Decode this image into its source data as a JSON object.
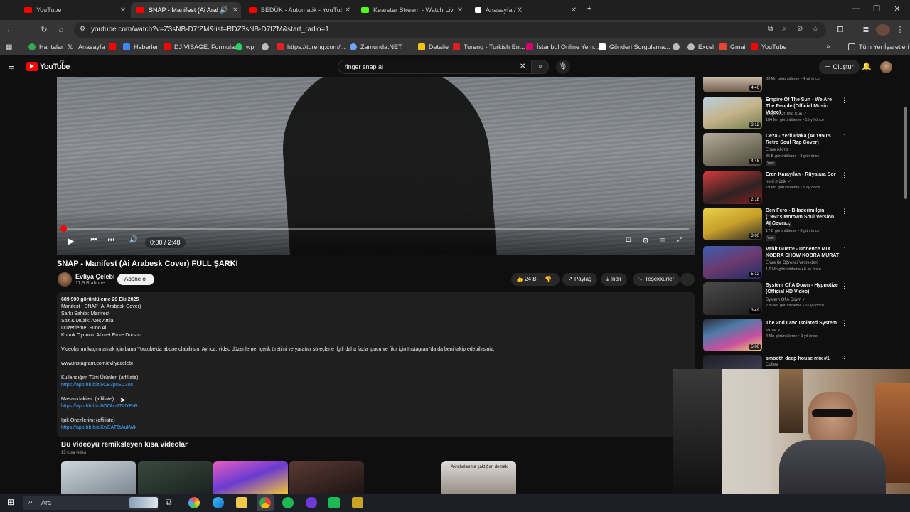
{
  "browser": {
    "tabs": [
      {
        "title": "YouTube",
        "favicon_color": "#ff0000",
        "active": false
      },
      {
        "title": "SNAP - Manifest (Ai Arabe",
        "favicon_color": "#ff0000",
        "active": true
      },
      {
        "title": "BEDÜK - Automatik - YouTube",
        "favicon_color": "#ff0000",
        "active": false
      },
      {
        "title": "Kearster Stream - Watch Live on",
        "favicon_color": "#53fc18",
        "active": false
      },
      {
        "title": "Anasayfa / X",
        "favicon_color": "#ffffff",
        "active": false
      }
    ],
    "url": "youtube.com/watch?v=Z3sNB-D7fZM&list=RDZ3sNB-D7fZM&start_radio=1",
    "bookmarks": [
      {
        "label": "Haritalar",
        "color": "#34a853"
      },
      {
        "label": "Anasayfa",
        "color": "#ffffff"
      },
      {
        "label": "",
        "color": "#ff0000"
      },
      {
        "label": "Haberler",
        "color": "#4285f4"
      },
      {
        "label": "DJ VISAGE: Formula...",
        "color": "#ff0000"
      },
      {
        "label": "wp",
        "color": "#25d366"
      },
      {
        "label": "",
        "color": "#bbbbbb"
      },
      {
        "label": "https://tureng.com/...",
        "color": "#e31e24"
      },
      {
        "label": "Zamunda.NET",
        "color": "#6aa6ff"
      },
      {
        "label": "Detaile",
        "color": "#f4c20d"
      },
      {
        "label": "Tureng - Turkish En...",
        "color": "#e31e24"
      },
      {
        "label": "İstanbul Online Yem...",
        "color": "#d6006f"
      },
      {
        "label": "Gönderi Sorgulama...",
        "color": "#ffffff"
      },
      {
        "label": "",
        "color": "#bbbbbb"
      },
      {
        "label": "Excel",
        "color": "#bbbbbb"
      },
      {
        "label": "Gmail",
        "color": "#ea4335"
      },
      {
        "label": "YouTube",
        "color": "#ff0000"
      }
    ],
    "all_bookmarks": "Tüm Yer İşaretleri"
  },
  "youtube": {
    "logo": "YouTube",
    "logo_country": "TR",
    "search_query": "finger snap ai",
    "create_label": "Oluştur"
  },
  "player": {
    "time": "0:00 / 2:48",
    "progress": 0.0
  },
  "video": {
    "title": "SNAP - Manifest (Ai Arabesk Cover) FULL ŞARKI",
    "channel": "Evliya Çelebi",
    "subscribers": "11,9 B abone",
    "subscribe_label": "Abone ol",
    "likes": "24 B",
    "share_label": "Paylaş",
    "download_label": "İndir",
    "thanks_label": "Teşekkürler",
    "description": [
      {
        "text": "689.990 görüntüleme  29 Eki 2025",
        "link": false
      },
      {
        "text": "Manifest - SNAP (Ai Arabesk Cover)",
        "link": false
      },
      {
        "text": "Şarkı Sahibi: Manifest",
        "link": false
      },
      {
        "text": "Söz & Müzik: Ateş Attila",
        "link": false
      },
      {
        "text": "Düzenleme: Suno Ai",
        "link": false
      },
      {
        "text": "Konuk Oyuncu: Ahmet Emre Dursun",
        "link": false
      },
      {
        "text": "Videolarımı kaçırmamak için bana Youtube'da abone olabilirsin.  Ayrıca, video düzenleme, içerik üretimi ve yaratıcı süreçlerle ilgili daha fazla ipucu ve fikir için Instagram'da da beni takip edebilirsiniz.",
        "link": false
      },
      {
        "text": "www.instagram.com/evliyacelebi",
        "link": false
      },
      {
        "text": "Kullandığım Tüm Ürünler: (affiliate)",
        "link": false
      },
      {
        "text": "https://app.hb.biz/6CB3pcEC3os",
        "link": true
      },
      {
        "text": "Masamdakiler: (affiliate)",
        "link": false
      },
      {
        "text": "https://app.hb.biz/8OObu2ZUYBrR",
        "link": true
      },
      {
        "text": "Işık Önerilerim: (affiliate)",
        "link": false
      },
      {
        "text": "https://app.hb.biz/KwEAT6tAukWk",
        "link": true
      }
    ],
    "shorts_title": "Bu videoyu remiksleyen kısa videolar",
    "shorts_count": "15 kısa video",
    "short_caption": "Akrabalarıma çaktığım demek"
  },
  "recommendations": [
    {
      "title": "",
      "channel": "",
      "stats": "39 Mn görüntüleme • 4 yıl önce",
      "duration": "4:40",
      "badge": ""
    },
    {
      "title": "Empire Of The Sun - We Are The People (Official Music Video)",
      "channel": "Empire Of The Sun ✓",
      "stats": "184 Mn görüntüleme • 15 yıl önce",
      "duration": "3:12",
      "badge": ""
    },
    {
      "title": "Ceza - Yerli Plaka (AI 1950's Retro Soul Rap Cover)",
      "channel": "Emre Alkmz",
      "stats": "86 B görüntüleme • 3 gün önce",
      "duration": "4:48",
      "badge": "Yeni"
    },
    {
      "title": "Eren Karayılan - Rüyalara Sor",
      "channel": "netd müzik ✓",
      "stats": "79 Mn görüntüleme • 5 ay önce",
      "duration": "2:18",
      "badge": ""
    },
    {
      "title": "Ben Fero - Biladerim İçin (1960's Motown Soul Version AI Cover...",
      "channel": "Dijital Nostalji",
      "stats": "17 B görüntüleme • 3 gün önce",
      "duration": "3:00",
      "badge": "Yeni"
    },
    {
      "title": "Vahit Guette - Dönence MIX KOBRA SHOW KOBRA MURAT",
      "channel": "Emre İle Öğrenci Yemekleri",
      "stats": "1,9 Mn görüntüleme • 6 ay önce",
      "duration": "5:12",
      "badge": ""
    },
    {
      "title": "System Of A Down - Hypnotize (Official HD Video)",
      "channel": "System Of A Down ✓",
      "stats": "226 Mn görüntüleme • 16 yıl önce",
      "duration": "3:49",
      "badge": ""
    },
    {
      "title": "The 2nd Law: Isolated System",
      "channel": "Muse ✓",
      "stats": "4 Mn görüntüleme • 9 yıl önce",
      "duration": "5:00",
      "badge": ""
    },
    {
      "title": "smooth deep house mix #1",
      "channel": "Coffee",
      "stats": "",
      "duration": "",
      "badge": ""
    }
  ],
  "taskbar": {
    "search_placeholder": "Ara"
  },
  "colors": {
    "youtube_red": "#ff0000",
    "link_blue": "#3ea6ff",
    "background": "#0f0f0f"
  }
}
